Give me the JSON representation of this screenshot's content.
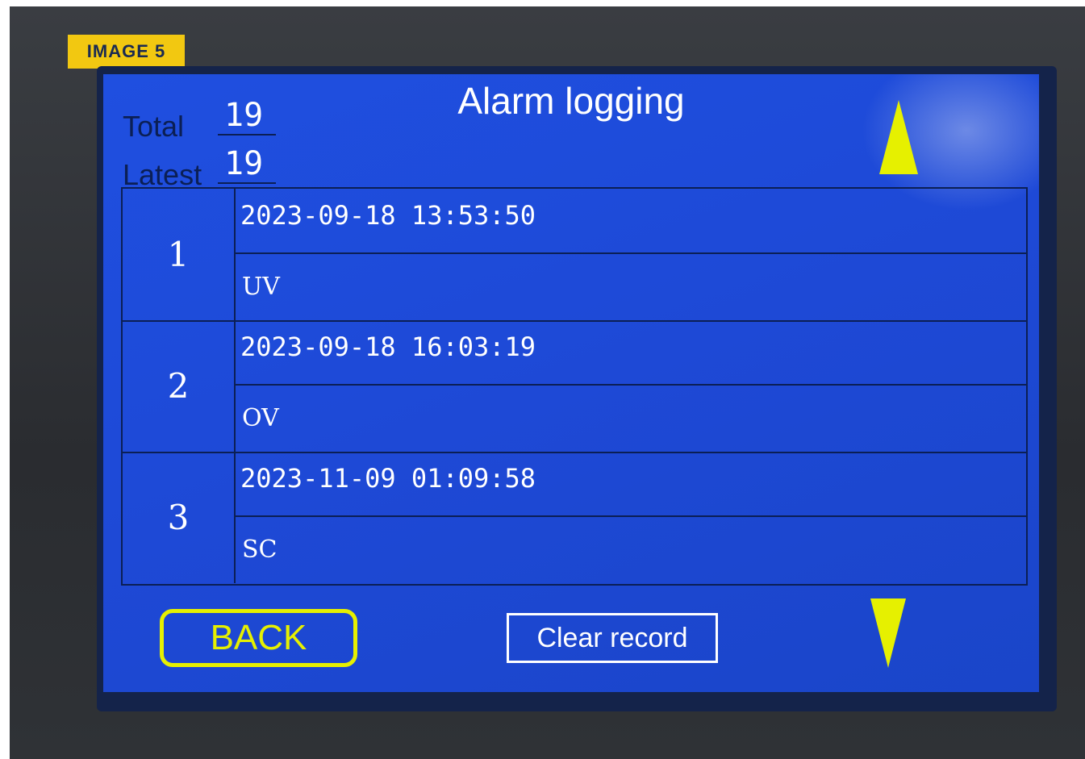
{
  "tag_label": "IMAGE 5",
  "header": {
    "title": "Alarm logging",
    "total_label": "Total",
    "total_value": "19",
    "latest_label": "Latest",
    "latest_value": "19"
  },
  "records": [
    {
      "index": "1",
      "timestamp": "2023-09-18 13:53:50",
      "code": "UV"
    },
    {
      "index": "2",
      "timestamp": "2023-09-18 16:03:19",
      "code": "OV"
    },
    {
      "index": "3",
      "timestamp": "2023-11-09 01:09:58",
      "code": "SC"
    }
  ],
  "footer": {
    "back_label": "BACK",
    "clear_label": "Clear record"
  },
  "icons": {
    "up": "triangle-up-icon",
    "down": "triangle-down-icon"
  },
  "colors": {
    "screen_blue": "#1f4fe0",
    "accent_yellow": "#e6f000",
    "tag_yellow": "#f2c811",
    "dark_navy": "#0b1f55"
  }
}
